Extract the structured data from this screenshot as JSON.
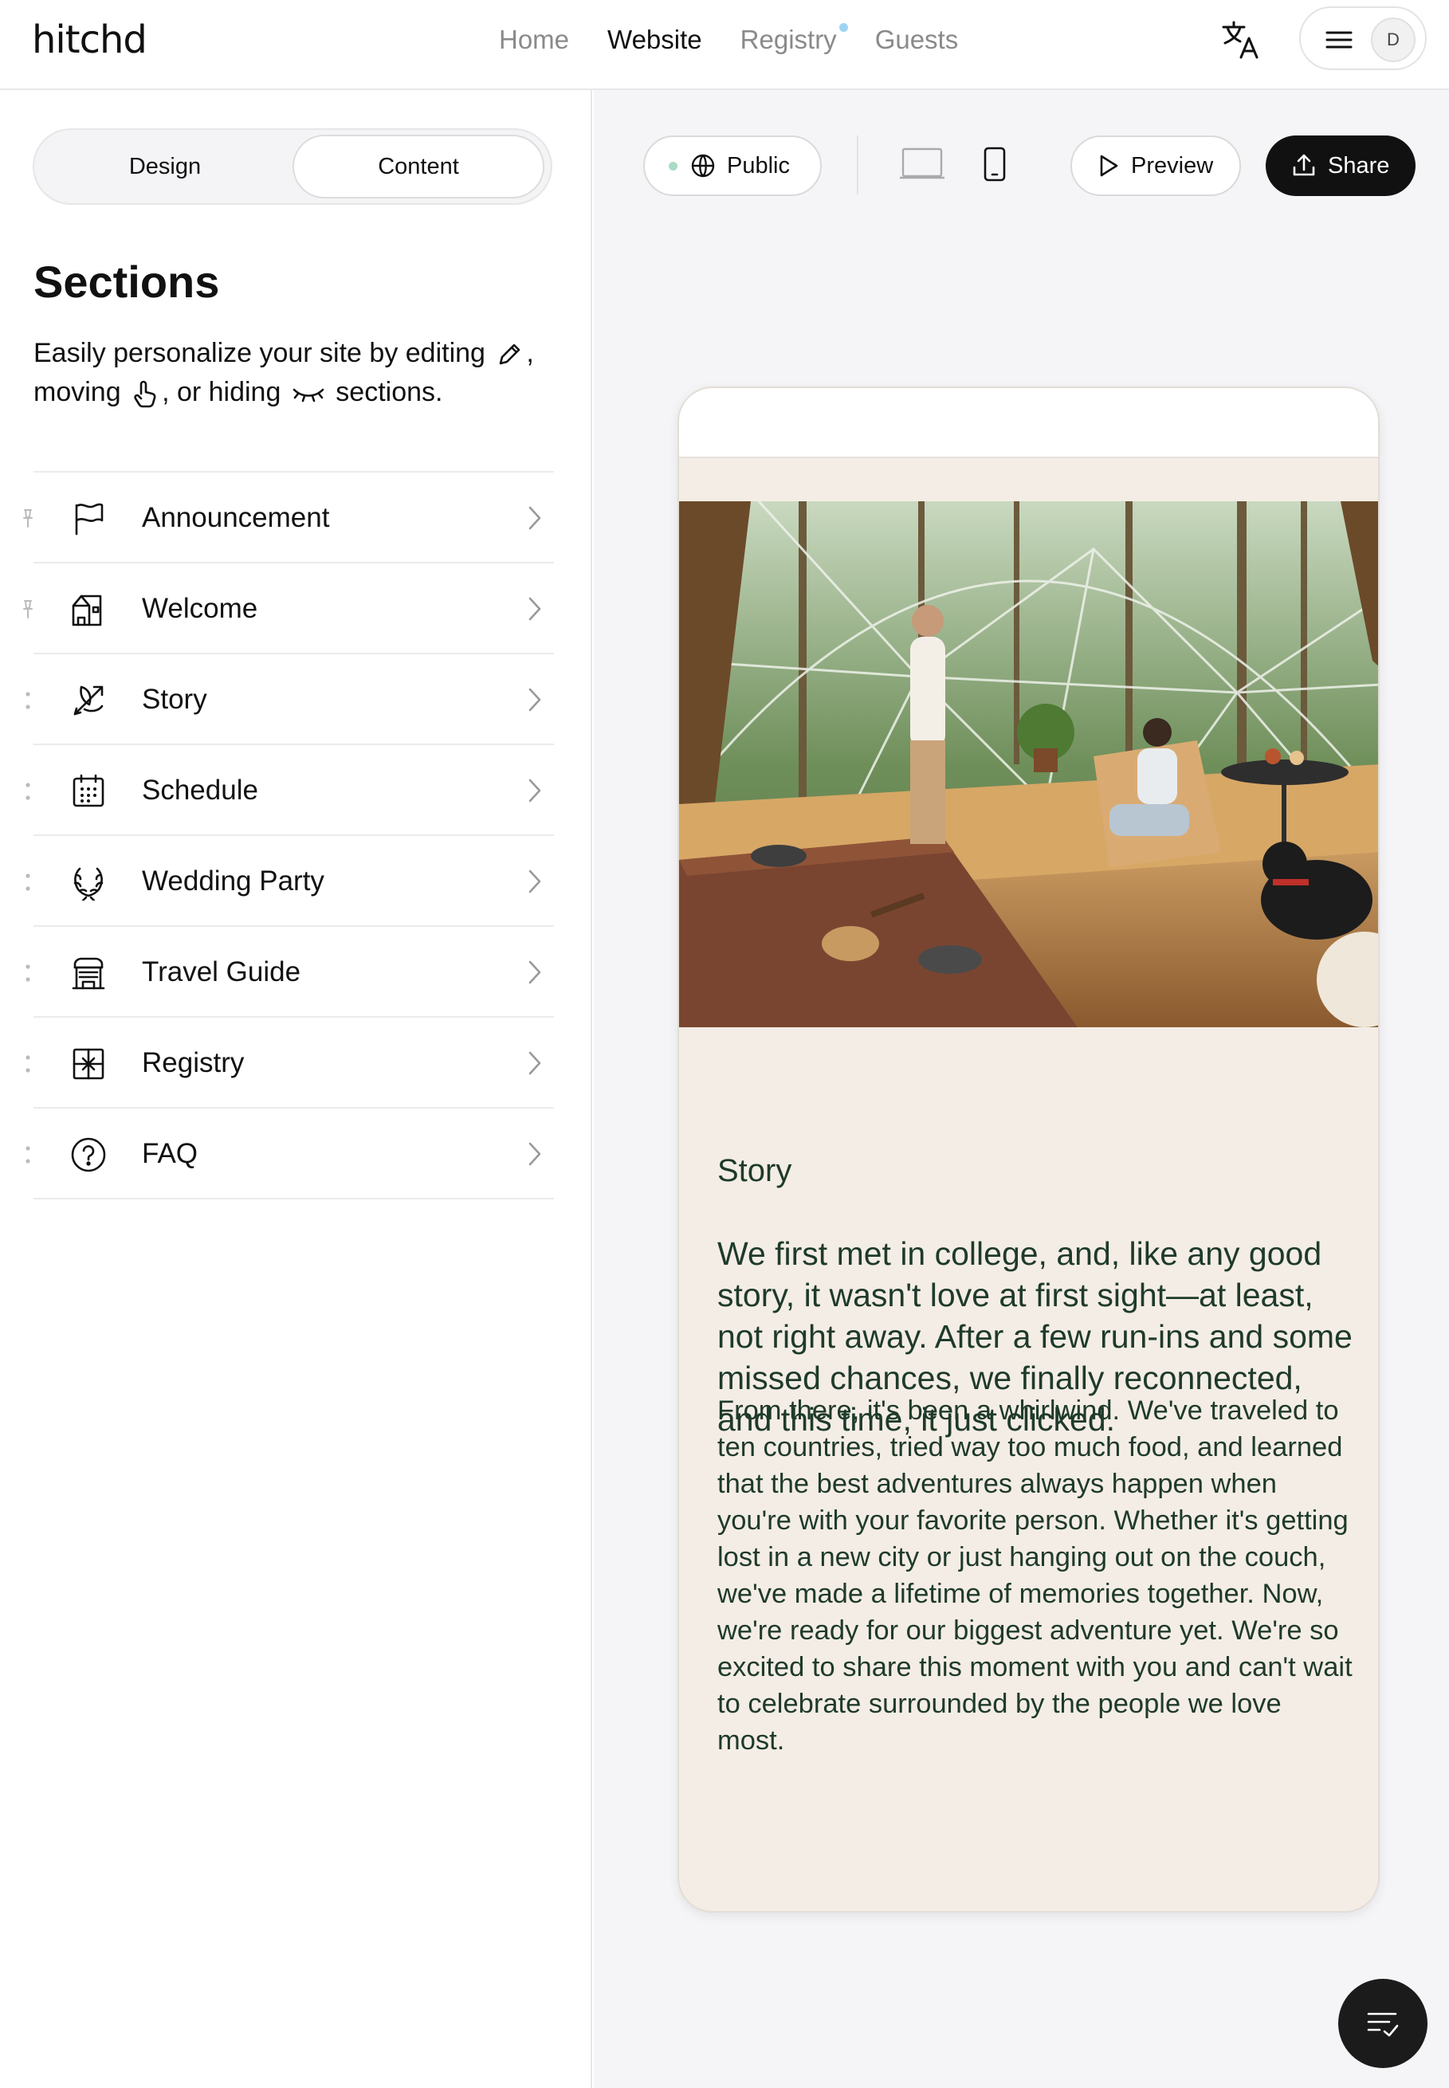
{
  "app": {
    "logo": "hitchd"
  },
  "nav": {
    "home": "Home",
    "website": "Website",
    "registry": "Registry",
    "guests": "Guests"
  },
  "user": {
    "avatar_initial": "D"
  },
  "sidebar": {
    "tabs": {
      "design": "Design",
      "content": "Content",
      "active": "Content"
    },
    "title": "Sections",
    "description": {
      "part1": "Easily personalize your site by editing",
      "part2": ", moving",
      "part3": ", or hiding",
      "part4": "sections."
    },
    "sections": [
      {
        "label": "Announcement",
        "icon": "flag-icon",
        "handle": "pin"
      },
      {
        "label": "Welcome",
        "icon": "house-icon",
        "handle": "pin"
      },
      {
        "label": "Story",
        "icon": "cupid-arrow-icon",
        "handle": "drag"
      },
      {
        "label": "Schedule",
        "icon": "calendar-icon",
        "handle": "drag"
      },
      {
        "label": "Wedding Party",
        "icon": "laurel-icon",
        "handle": "drag"
      },
      {
        "label": "Travel Guide",
        "icon": "building-icon",
        "handle": "drag"
      },
      {
        "label": "Registry",
        "icon": "gift-icon",
        "handle": "drag"
      },
      {
        "label": "FAQ",
        "icon": "question-icon",
        "handle": "drag"
      }
    ]
  },
  "toolbar": {
    "visibility": "Public",
    "preview": "Preview",
    "share": "Share"
  },
  "preview": {
    "story_heading": "Story",
    "story_lead": "We first met in college, and, like any good story, it wasn't love at first sight—at least, not right away. After a few run-ins and some missed chances, we finally reconnected, and this time, it just clicked.",
    "story_body": "From there, it's been a whirlwind. We've traveled to ten countries, tried way too much food, and learned that the best adventures always happen when you're with your favorite person. Whether it's getting lost in a new city or just hanging out on the couch, we've made a lifetime of memories together. Now, we're ready for our biggest adventure yet. We're so excited to share this moment with you and can't wait to celebrate surrounded by the people we love most."
  },
  "colors": {
    "accent_dark": "#111111",
    "story_text": "#1e3a2b",
    "preview_bg": "#f4ede5",
    "public_dot": "#a8dcc4",
    "registry_dot": "#9fd3f4"
  }
}
